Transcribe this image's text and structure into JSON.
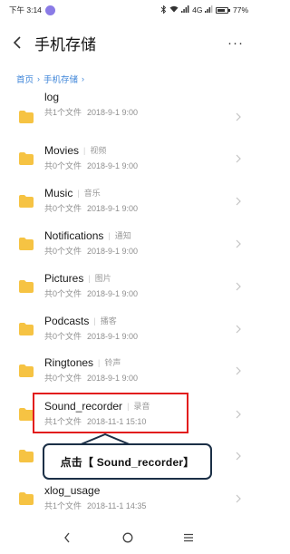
{
  "status_bar": {
    "time": "下午 3:14",
    "network": "4G",
    "battery": "77%"
  },
  "header": {
    "title": "手机存储",
    "more_label": "···"
  },
  "breadcrumb": {
    "items": [
      "首页",
      "手机存储"
    ]
  },
  "files": [
    {
      "name": "log",
      "alias": "",
      "count": "共1个文件",
      "date": "2018-9-1 9:00"
    },
    {
      "name": "Movies",
      "alias": "视频",
      "count": "共0个文件",
      "date": "2018-9-1 9:00"
    },
    {
      "name": "Music",
      "alias": "音乐",
      "count": "共0个文件",
      "date": "2018-9-1 9:00"
    },
    {
      "name": "Notifications",
      "alias": "通知",
      "count": "共0个文件",
      "date": "2018-9-1 9:00"
    },
    {
      "name": "Pictures",
      "alias": "图片",
      "count": "共0个文件",
      "date": "2018-9-1 9:00"
    },
    {
      "name": "Podcasts",
      "alias": "播客",
      "count": "共0个文件",
      "date": "2018-9-1 9:00"
    },
    {
      "name": "Ringtones",
      "alias": "铃声",
      "count": "共0个文件",
      "date": "2018-9-1 9:00"
    },
    {
      "name": "Sound_recorder",
      "alias": "录音",
      "count": "共1个文件",
      "date": "2018-11-1 15:10"
    },
    {
      "name": "",
      "alias": "",
      "count": "",
      "date": ""
    },
    {
      "name": "xlog_usage",
      "alias": "",
      "count": "共1个文件",
      "date": "2018-11-1 14:35"
    }
  ],
  "callout": {
    "text": "点击【 Sound_recorder】"
  },
  "colors": {
    "folder": "#f6c343",
    "link": "#3f86d9",
    "highlight": "#e21d1d",
    "callout_border": "#1b2f46"
  }
}
